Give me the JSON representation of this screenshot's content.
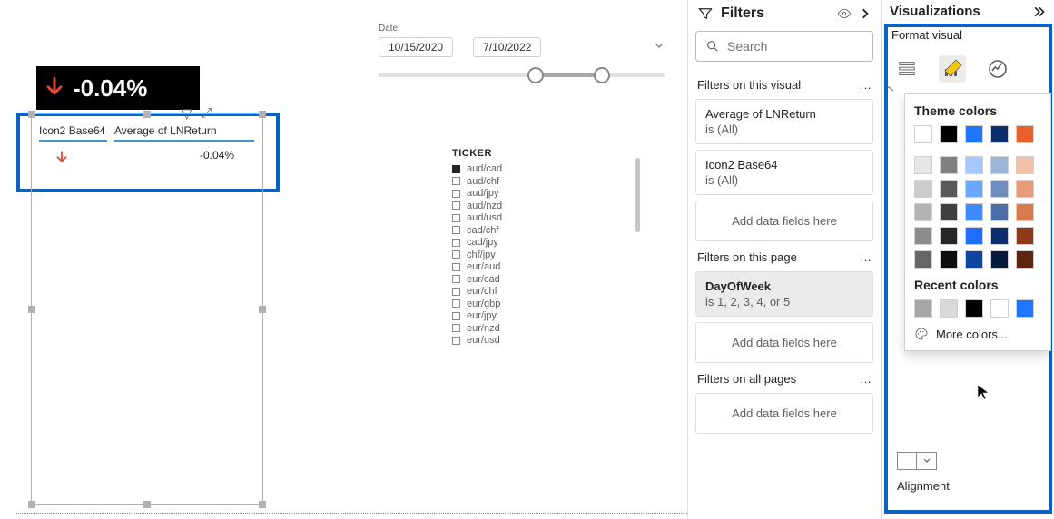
{
  "date_slicer": {
    "label": "Date",
    "start": "10/15/2020",
    "end": "7/10/2022"
  },
  "kpi": {
    "value": "-0.04%"
  },
  "visual_toolbar": {
    "filter": "▽",
    "focus": "⤢",
    "more": "⋯"
  },
  "table": {
    "col1_header": "Icon2 Base64",
    "col2_header": "Average of LNReturn",
    "row1_value": "-0.04%"
  },
  "ticker": {
    "title": "TICKER",
    "items": [
      "aud/cad",
      "aud/chf",
      "aud/jpy",
      "aud/nzd",
      "aud/usd",
      "cad/chf",
      "cad/jpy",
      "chf/jpy",
      "eur/aud",
      "eur/cad",
      "eur/chf",
      "eur/gbp",
      "eur/jpy",
      "eur/nzd",
      "eur/usd"
    ]
  },
  "filters_pane": {
    "title": "Filters",
    "search_placeholder": "Search",
    "section_visual": "Filters on this visual",
    "section_page": "Filters on this page",
    "section_all": "Filters on all pages",
    "add_fields": "Add data fields here",
    "dots": "…",
    "card1_title": "Average of LNReturn",
    "card1_value": "is (All)",
    "card2_title": "Icon2 Base64",
    "card2_value": "is (All)",
    "page_card_title": "DayOfWeek",
    "page_card_value": "is 1, 2, 3, 4, or 5"
  },
  "viz_pane": {
    "title": "Visualizations",
    "subtitle": "Format visual",
    "alignment_label": "Alignment"
  },
  "color_picker": {
    "theme_title": "Theme colors",
    "recent_title": "Recent colors",
    "more_label": "More colors...",
    "theme_rows": [
      [
        "#ffffff",
        "#000000",
        "#1f77ff",
        "#0b2f6b",
        "#e8602c"
      ],
      [
        "#e6e6e6",
        "#808080",
        "#a6c8ff",
        "#9eb5da",
        "#f2bfa8"
      ],
      [
        "#cccccc",
        "#595959",
        "#6aa8ff",
        "#6f8ec0",
        "#e89b7a"
      ],
      [
        "#b3b3b3",
        "#404040",
        "#3d8bff",
        "#4a6ea6",
        "#d97a4d"
      ],
      [
        "#8c8c8c",
        "#262626",
        "#1f6eff",
        "#0b2f6b",
        "#8b3a1a"
      ],
      [
        "#666666",
        "#0d0d0d",
        "#0d47a1",
        "#061a3d",
        "#5c2610"
      ]
    ],
    "recent": [
      "#a6a6a6",
      "#d9d9d9",
      "#000000",
      "#ffffff",
      "#1f77ff"
    ]
  }
}
